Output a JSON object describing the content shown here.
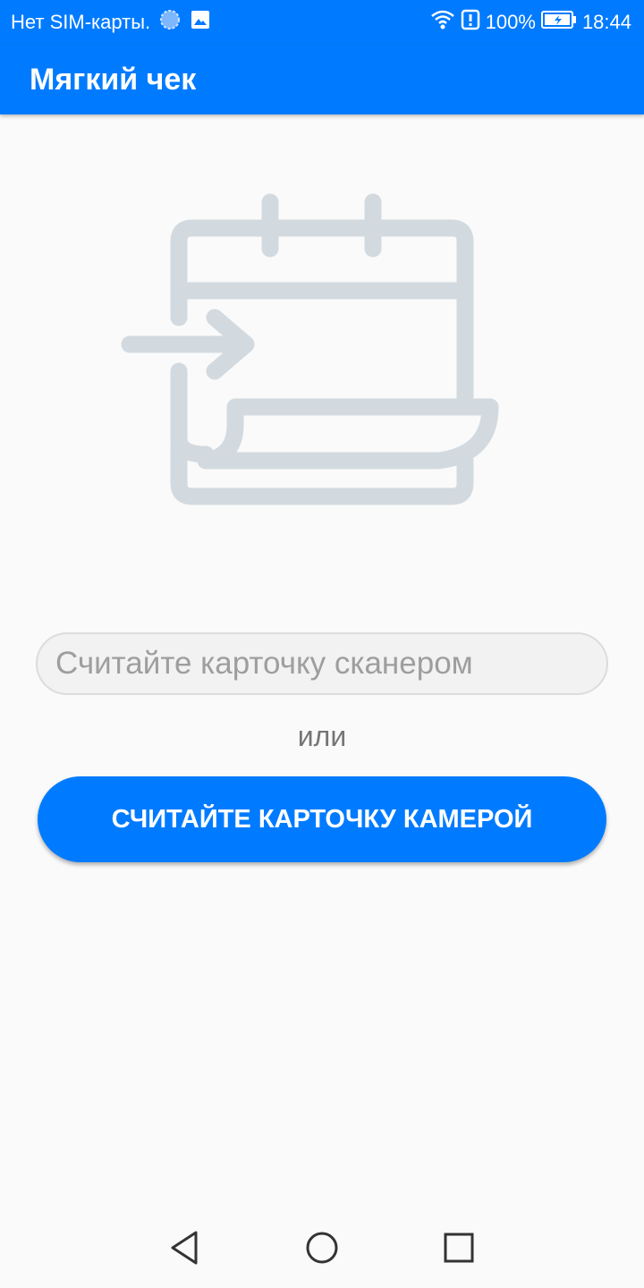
{
  "status_bar": {
    "carrier_text": "Нет SIM-карты.",
    "battery_percent": "100%",
    "time": "18:44",
    "icons": [
      "loading-dot-icon",
      "image-icon",
      "wifi-icon",
      "alert-icon",
      "battery-charging-icon"
    ]
  },
  "app_bar": {
    "title": "Мягкий чек",
    "color": "#007bff"
  },
  "illustration": {
    "icon": "card-insert-illustration",
    "color": "#d3dadf"
  },
  "scan_input": {
    "placeholder": "Считайте карточку сканером",
    "value": ""
  },
  "divider_text": "или",
  "camera_button": {
    "label": "СЧИТАЙТЕ КАРТОЧКУ КАМЕРОЙ",
    "color": "#007bff"
  },
  "nav_bar": {
    "buttons": [
      "back-icon",
      "home-icon",
      "recents-icon"
    ]
  }
}
